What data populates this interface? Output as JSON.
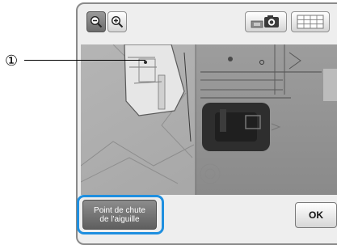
{
  "callout": {
    "number": "①"
  },
  "toolbar": {
    "zoom_out_icon": "zoom-out-icon",
    "zoom_in_icon": "zoom-in-icon",
    "camera_icon": "camera-icon",
    "grid_icon": "grid-icon"
  },
  "buttons": {
    "needle_drop_line1": "Point de chute",
    "needle_drop_line2": "de l'aiguille",
    "ok_label": "OK"
  },
  "colors": {
    "highlight": "#1f8fdf",
    "screen_bg": "#eeeeee",
    "dark_button": "#6c6c6c"
  }
}
